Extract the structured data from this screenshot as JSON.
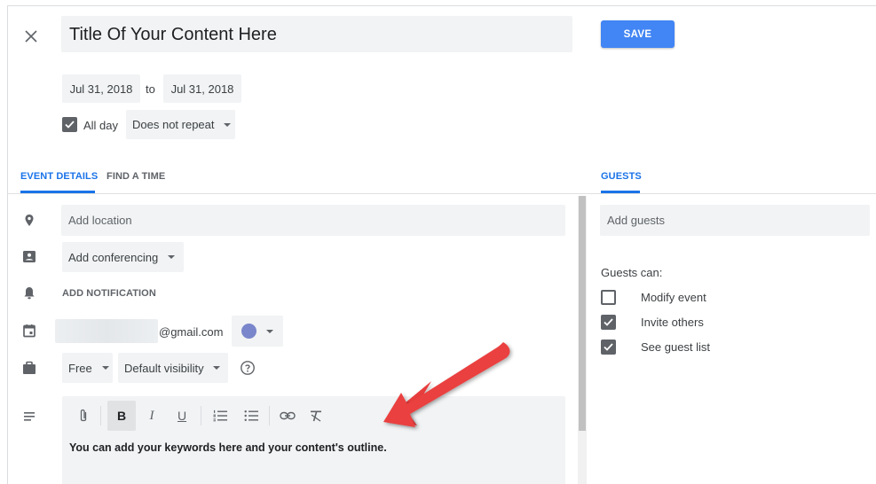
{
  "header": {
    "title": "Title Of Your Content Here",
    "save_label": "SAVE",
    "close_icon": "close-icon"
  },
  "dates": {
    "start": "Jul 31, 2018",
    "to_label": "to",
    "end": "Jul 31, 2018"
  },
  "options": {
    "all_day_label": "All day",
    "all_day_checked": true,
    "repeat_value": "Does not repeat"
  },
  "tabs": {
    "event_details": "EVENT DETAILS",
    "find_a_time": "FIND A TIME",
    "guests": "GUESTS",
    "active_color": "#1a73e8"
  },
  "details": {
    "location_placeholder": "Add location",
    "conferencing_value": "Add conferencing",
    "add_notification": "ADD NOTIFICATION",
    "calendar_email": "@gmail.com",
    "calendar_color": "#7986cb",
    "availability_value": "Free",
    "visibility_value": "Default visibility",
    "help_icon": "help-icon"
  },
  "description": {
    "text": "You can add your keywords here and your content's outline.",
    "toolbar": [
      "attachment-icon",
      "bold-icon",
      "italic-icon",
      "underline-icon",
      "numbered-list-icon",
      "bulleted-list-icon",
      "link-icon",
      "clear-format-icon"
    ]
  },
  "guests": {
    "add_placeholder": "Add guests",
    "can_label": "Guests can:",
    "permissions": [
      {
        "label": "Modify event",
        "checked": false
      },
      {
        "label": "Invite others",
        "checked": true
      },
      {
        "label": "See guest list",
        "checked": true
      }
    ]
  },
  "annotation": {
    "arrow_color": "#e83e3e"
  }
}
